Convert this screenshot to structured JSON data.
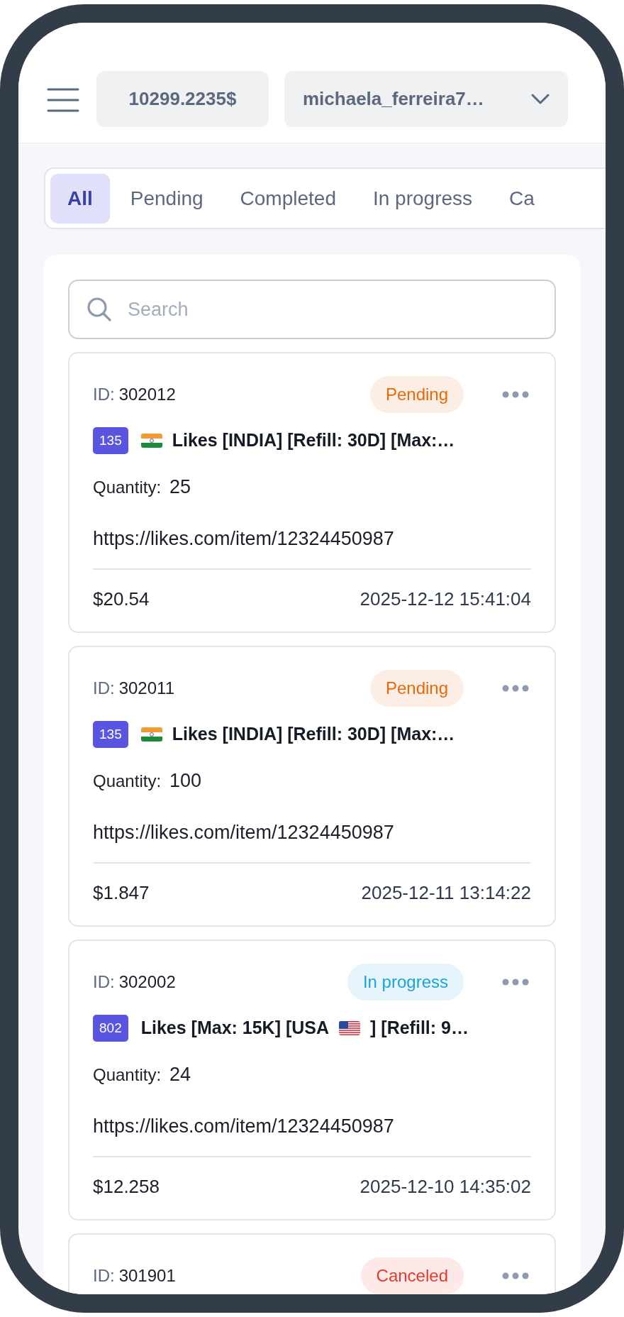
{
  "header": {
    "balance": "10299.2235$",
    "account": "michaela_ferreira7…"
  },
  "tabs": [
    {
      "label": "All",
      "selected": true
    },
    {
      "label": "Pending",
      "selected": false
    },
    {
      "label": "Completed",
      "selected": false
    },
    {
      "label": "In progress",
      "selected": false
    },
    {
      "label": "Ca",
      "selected": false
    }
  ],
  "search": {
    "placeholder": "Search"
  },
  "orders": [
    {
      "id_label": "ID:",
      "id": "302012",
      "status": {
        "label": "Pending",
        "color": "#e8680c"
      },
      "service_id": "135",
      "title_parts": [
        {
          "kind": "flag_in"
        },
        {
          "kind": "text",
          "text": "Likes [INDIA] [Refill: 30D] [Max:…"
        }
      ],
      "quantity_label": "Quantity:",
      "quantity": "25",
      "link": "https://likes.com/item/12324450987",
      "price": "$20.54",
      "date": "2025-12-12 15:41:04"
    },
    {
      "id_label": "ID:",
      "id": "302011",
      "status": {
        "label": "Pending",
        "color": "#e8680c"
      },
      "service_id": "135",
      "title_parts": [
        {
          "kind": "flag_in"
        },
        {
          "kind": "text",
          "text": "Likes [INDIA] [Refill: 30D] [Max:…"
        }
      ],
      "quantity_label": "Quantity:",
      "quantity": "100",
      "link": "https://likes.com/item/12324450987",
      "price": "$1.847",
      "date": "2025-12-11 13:14:22"
    },
    {
      "id_label": "ID:",
      "id": "302002",
      "status": {
        "label": "In progress",
        "color": "#1aa3d9"
      },
      "service_id": "802",
      "title_parts": [
        {
          "kind": "text",
          "text": "Likes [Max: 15K] [USA"
        },
        {
          "kind": "flag_us"
        },
        {
          "kind": "text",
          "text": "] [Refill: 9…"
        }
      ],
      "quantity_label": "Quantity:",
      "quantity": "24",
      "link": "https://likes.com/item/12324450987",
      "price": "$12.258",
      "date": "2025-12-10 14:35:02"
    },
    {
      "id_label": "ID:",
      "id": "301901",
      "status": {
        "label": "Canceled",
        "color": "#e5392b"
      }
    }
  ]
}
